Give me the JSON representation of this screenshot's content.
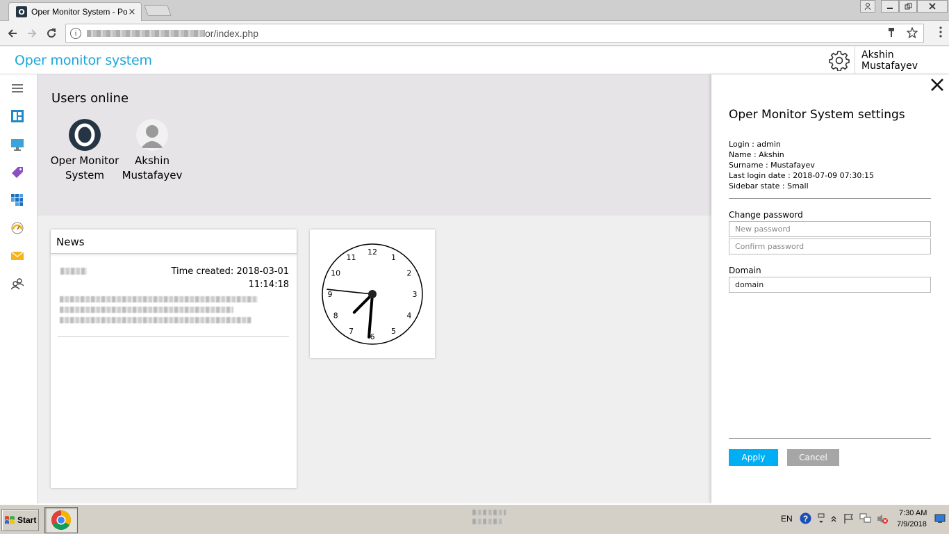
{
  "browser": {
    "tab_title": "Oper Monitor System - Port",
    "tab_favicon_letter": "O",
    "tab_close": "×",
    "url_suffix": "or/index.php",
    "back_icon": "arrow-left-icon",
    "forward_icon": "arrow-right-icon",
    "reload_icon": "reload-icon"
  },
  "header": {
    "app_title": "Oper monitor system",
    "user_name": "Akshin Mustafayev",
    "accent_color": "#1aa6d9"
  },
  "sidebar": {
    "items": [
      {
        "icon": "hamburger-menu-icon"
      },
      {
        "icon": "dashboard-icon"
      },
      {
        "icon": "monitor-icon"
      },
      {
        "icon": "tag-icon"
      },
      {
        "icon": "cubes-icon"
      },
      {
        "icon": "speedometer-icon"
      },
      {
        "icon": "mail-icon"
      },
      {
        "icon": "users-icon"
      }
    ]
  },
  "users_online": {
    "title": "Users online",
    "users": [
      {
        "name": "Oper Monitor System",
        "avatar": "logo-avatar"
      },
      {
        "name": "Akshin Mustafayev",
        "avatar": "person-avatar"
      }
    ]
  },
  "news": {
    "title": "News",
    "time_label": "Time created: 2018-03-01",
    "time_value": "11:14:18"
  },
  "clock": {
    "hour": 7,
    "minute": 30,
    "second": 46,
    "numbers": [
      "12",
      "1",
      "2",
      "3",
      "4",
      "5",
      "6",
      "7",
      "8",
      "9",
      "10",
      "11"
    ]
  },
  "settings": {
    "title": "Oper Monitor System settings",
    "login": "Login : admin",
    "name": "Name : Akshin",
    "surname": "Surname : Mustafayev",
    "last_login": "Last login date : 2018-07-09 07:30:15",
    "sidebar_state": "Sidebar state : Small",
    "change_password_label": "Change password",
    "new_password_placeholder": "New password",
    "confirm_password_placeholder": "Confirm password",
    "domain_label": "Domain",
    "domain_value": "domain",
    "apply_label": "Apply",
    "cancel_label": "Cancel",
    "apply_color": "#00aef4",
    "cancel_color": "#a6a6a6"
  },
  "taskbar": {
    "start_label": "Start",
    "lang": "EN",
    "time": "7:30 AM",
    "date": "7/9/2018"
  }
}
